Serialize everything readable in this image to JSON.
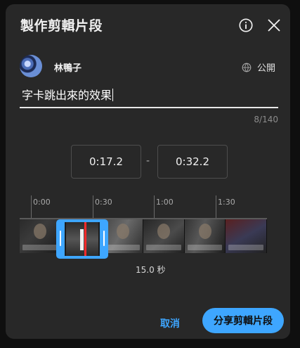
{
  "dialog": {
    "title": "製作剪輯片段"
  },
  "user": {
    "name": "林鴨子",
    "avatar_icon": "avatar-icon"
  },
  "privacy": {
    "label": "公開",
    "icon": "globe-icon"
  },
  "clip": {
    "title_value": "字卡跳出來的效果",
    "char_counter": "8/140",
    "start_time": "0:17.2",
    "separator": "-",
    "end_time": "0:32.2",
    "duration_label": "15.0 秒"
  },
  "timeline": {
    "ticks": [
      "0:00",
      "0:30",
      "1:00",
      "1:30"
    ]
  },
  "actions": {
    "cancel_label": "取消",
    "share_label": "分享剪輯片段"
  },
  "colors": {
    "accent": "#3ea6ff",
    "dialog_bg": "#282828",
    "page_bg": "#0f0f0f"
  }
}
